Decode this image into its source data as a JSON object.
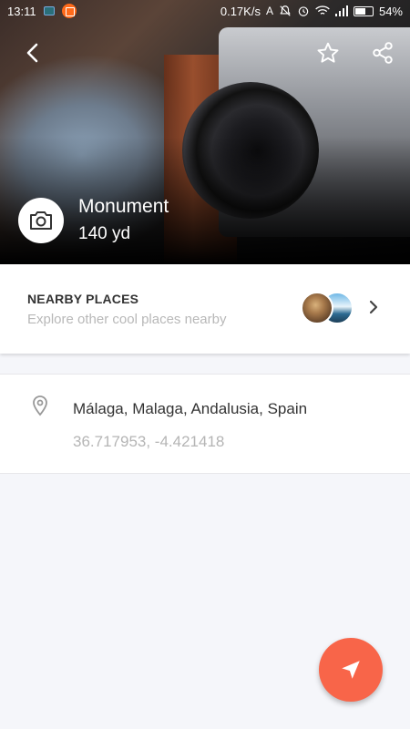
{
  "status_bar": {
    "time": "13:11",
    "network_speed": "0.17K/s",
    "battery": "54%",
    "battery_level": 0.54
  },
  "hero": {
    "title": "Monument",
    "distance": "140 yd",
    "category_icon": "camera-icon"
  },
  "nearby": {
    "title": "NEARBY PLACES",
    "subtitle": "Explore other cool places nearby"
  },
  "location": {
    "address": "Málaga, Malaga, Andalusia, Spain",
    "coordinates": "36.717953, -4.421418"
  },
  "colors": {
    "accent": "#f86549",
    "background": "#f5f6fa"
  }
}
